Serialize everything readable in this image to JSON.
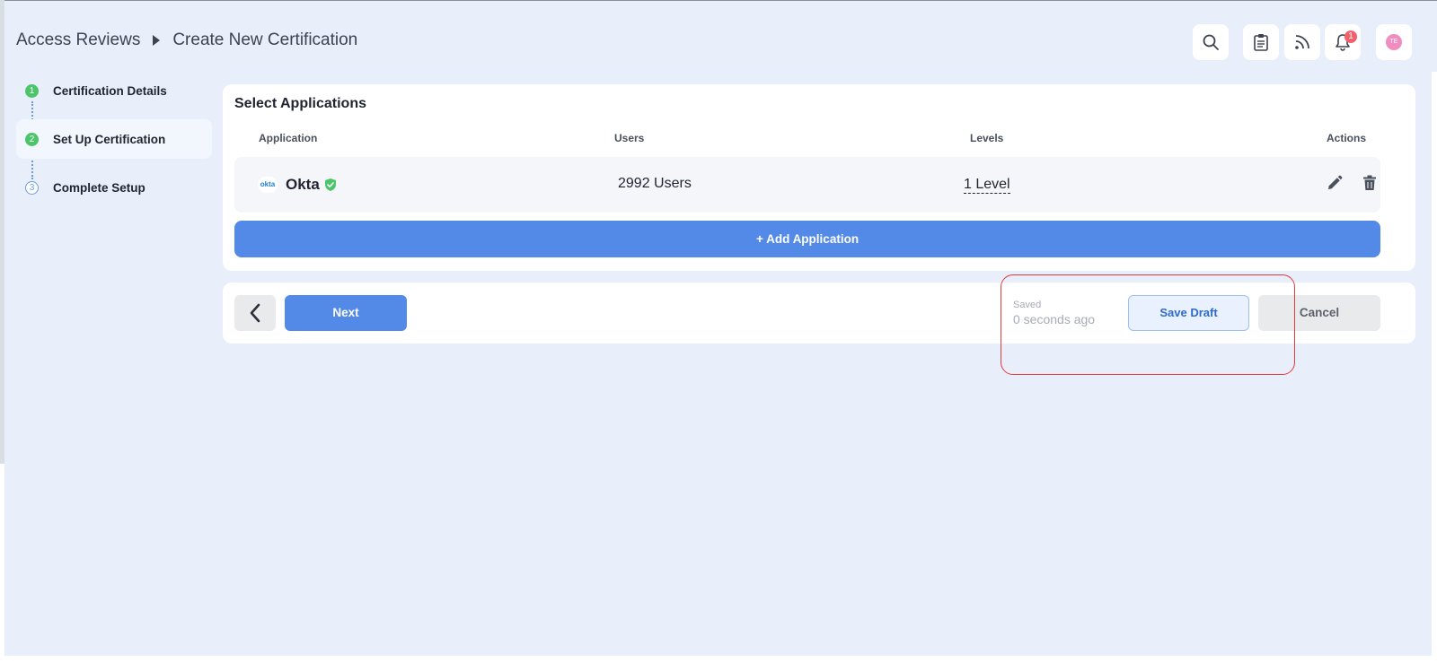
{
  "breadcrumb": {
    "parent": "Access Reviews",
    "current": "Create New Certification"
  },
  "header": {
    "notification_count": "1",
    "avatar_initials": "TE",
    "icons": [
      "search-icon",
      "clipboard-icon",
      "rss-icon",
      "bell-icon"
    ]
  },
  "stepper": {
    "steps": [
      {
        "num": "1",
        "label": "Certification Details",
        "state": "done"
      },
      {
        "num": "2",
        "label": "Set Up Certification",
        "state": "active"
      },
      {
        "num": "3",
        "label": "Complete Setup",
        "state": "todo"
      }
    ]
  },
  "applications": {
    "title": "Select Applications",
    "columns": {
      "application": "Application",
      "users": "Users",
      "levels": "Levels",
      "actions": "Actions"
    },
    "rows": [
      {
        "logo_text": "okta",
        "name": "Okta",
        "users": "2992 Users",
        "levels": "1 Level"
      }
    ],
    "add_label": "+ Add Application"
  },
  "footer": {
    "next_label": "Next",
    "saved_label": "Saved",
    "saved_time": "0 seconds ago",
    "save_draft_label": "Save Draft",
    "cancel_label": "Cancel"
  },
  "colors": {
    "accent": "#5389e7",
    "success": "#4cc46a",
    "badge": "#f0616b",
    "highlight": "#e23b3b"
  }
}
